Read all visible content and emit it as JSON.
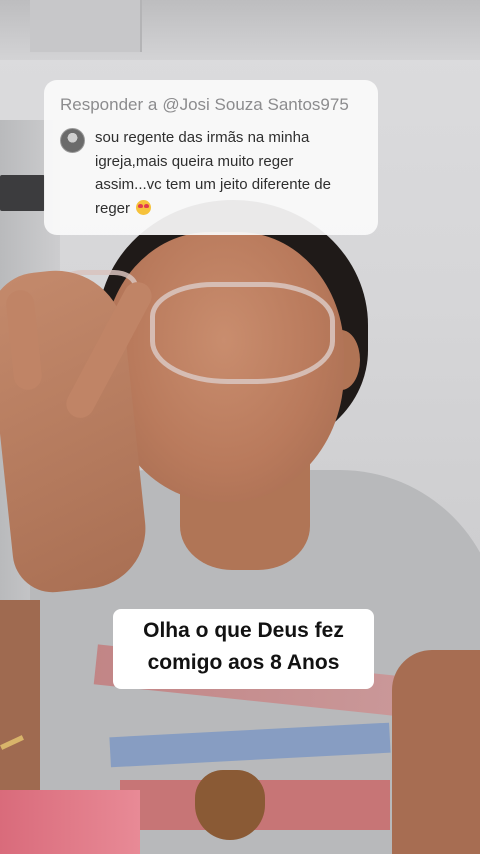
{
  "reply": {
    "prefix": "Responder a",
    "username": "@Josi Souza Santos975",
    "comment_lines": [
      "sou regente das irmãs na minha",
      "igreja,mais queira muito reger",
      "assim...vc tem um jeito diferente de",
      "reger"
    ],
    "emoji": "heart-eyes-emoji"
  },
  "caption": {
    "line1": "Olha o que Deus fez",
    "line2": "comigo aos 8 Anos"
  },
  "colors": {
    "card_bg": "#fafafa",
    "header_text": "#8c8c8e",
    "comment_text": "#2f2f2f",
    "caption_bg": "#ffffff",
    "caption_text": "#121212"
  }
}
